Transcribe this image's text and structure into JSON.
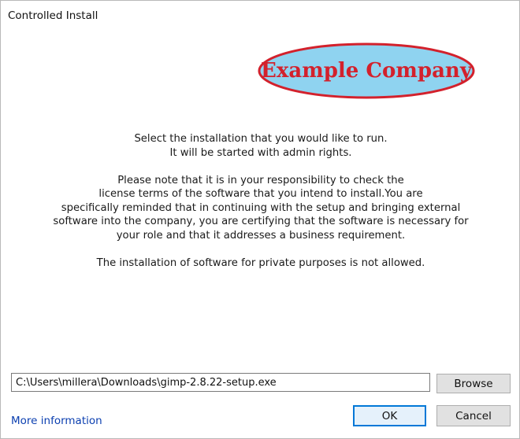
{
  "window": {
    "title": "Controlled Install"
  },
  "logo": {
    "text": "Example Company",
    "fill_color": "#8fd3f0",
    "border_color": "#d3212c",
    "text_color": "#d3212c"
  },
  "message": {
    "lines": [
      "Select the installation that you would like to run.",
      "It will be started with admin rights.",
      "",
      "Please note that it is in your responsibility to check the",
      "license terms of the software that you intend to install.You are",
      "specifically reminded that in continuing with the setup and bringing external",
      "software into the company, you are certifying that the software is necessary for",
      "your role and that it addresses a business requirement.",
      "",
      "The installation of software for private purposes is not allowed."
    ]
  },
  "installer_path": {
    "value": "C:\\Users\\millera\\Downloads\\gimp-2.8.22-setup.exe"
  },
  "buttons": {
    "browse": "Browse",
    "ok": "OK",
    "cancel": "Cancel"
  },
  "links": {
    "more_information": "More information"
  }
}
